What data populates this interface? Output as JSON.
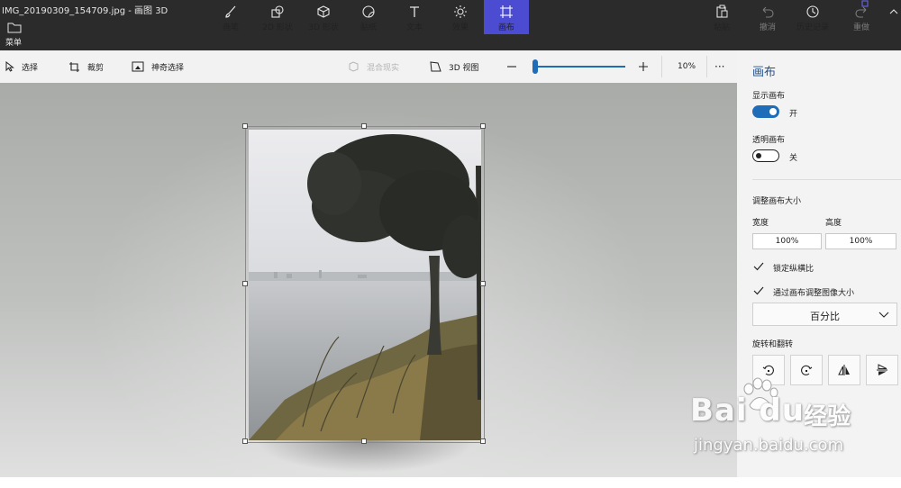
{
  "window": {
    "title": "IMG_20190309_154709.jpg - 画图 3D"
  },
  "ribbon": {
    "menu_label": "菜单",
    "tools": [
      {
        "label": "画笔",
        "icon": "brush-icon"
      },
      {
        "label": "2D 形状",
        "icon": "2d-shapes-icon"
      },
      {
        "label": "3D 形状",
        "icon": "3d-shapes-icon"
      },
      {
        "label": "贴纸",
        "icon": "stickers-icon"
      },
      {
        "label": "文本",
        "icon": "text-icon"
      },
      {
        "label": "效果",
        "icon": "effects-icon"
      },
      {
        "label": "画布",
        "icon": "canvas-icon",
        "active": true
      }
    ],
    "right": [
      {
        "label": "粘贴",
        "icon": "paste-icon"
      },
      {
        "label": "撤消",
        "icon": "undo-icon",
        "disabled": true
      },
      {
        "label": "历史记录",
        "icon": "history-icon"
      },
      {
        "label": "重做",
        "icon": "redo-icon",
        "disabled": true
      }
    ],
    "accent_color": "#4b4cd2"
  },
  "toolbar": {
    "select_label": "选择",
    "crop_label": "裁剪",
    "magic_select_label": "神奇选择",
    "mixed_reality_label": "混合现实",
    "view3d_label": "3D 视图",
    "zoom_level": "10%",
    "zoom_fraction": 0.02,
    "more_label": "···"
  },
  "panel": {
    "title": "画布",
    "show_canvas_label": "显示画布",
    "show_canvas_state": "开",
    "transparent_canvas_label": "透明画布",
    "transparent_canvas_state": "关",
    "resize_heading": "调整画布大小",
    "width_label": "宽度",
    "height_label": "高度",
    "width_value": "100%",
    "height_value": "100%",
    "lock_aspect_label": "锁定纵横比",
    "resize_image_label": "通过画布调整图像大小",
    "unit_select": "百分比",
    "rotate_heading": "旋转和翻转",
    "accent_color": "#1f6db8"
  },
  "watermark": {
    "brand": "Bai du",
    "cn": "经验",
    "url": "jingyan.baidu.com"
  }
}
